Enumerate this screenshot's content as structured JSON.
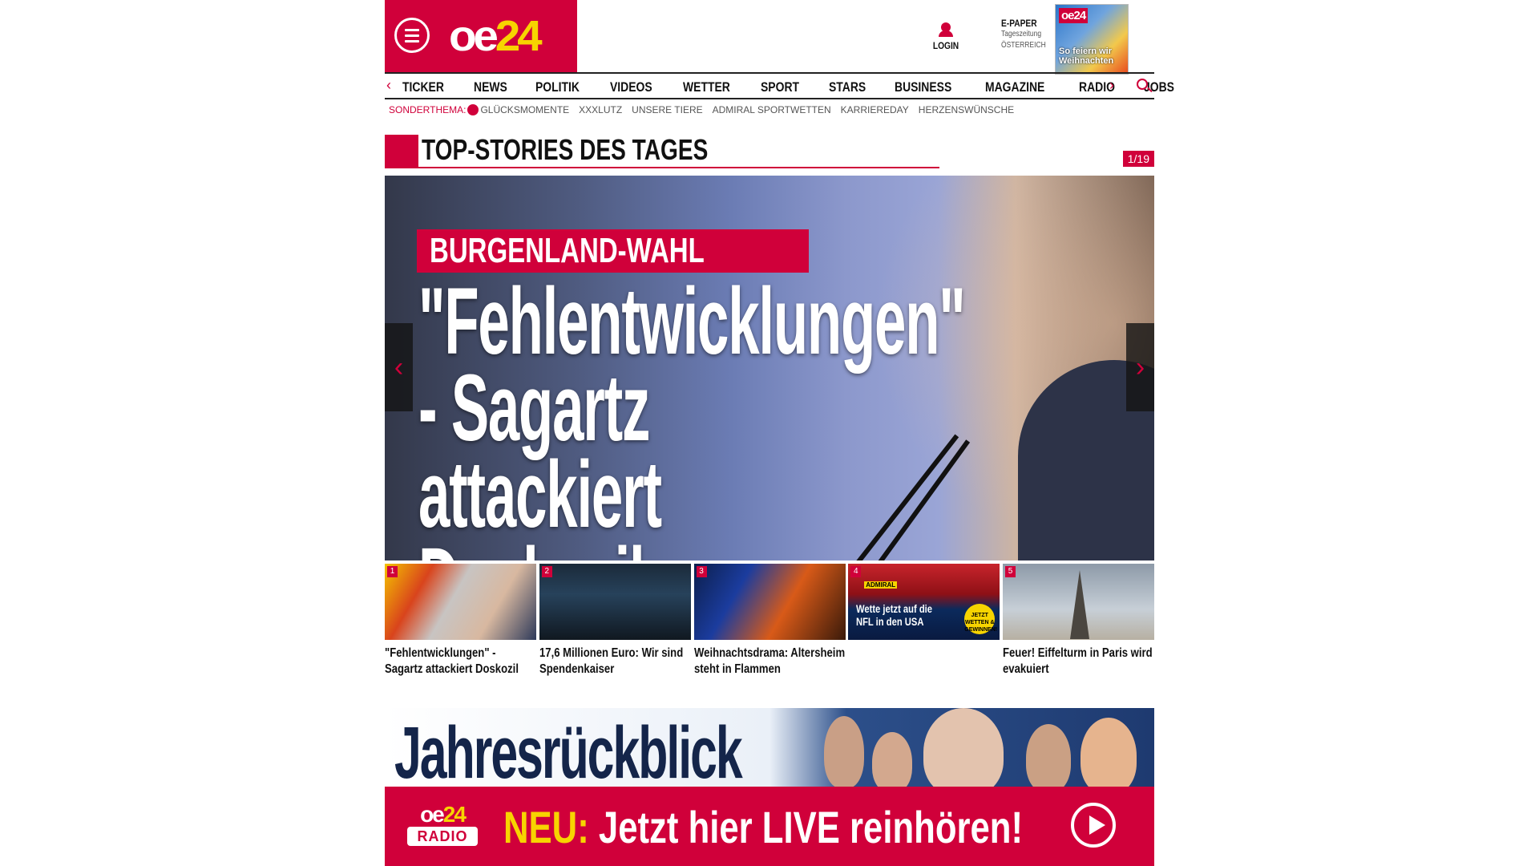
{
  "header": {
    "logo_oe": "oe",
    "logo_24": "24",
    "login_label": "LOGIN",
    "epaper_title": "E-PAPER",
    "epaper_line1": "Tageszeitung",
    "epaper_line2": "ÖSTERREICH",
    "cover_logo": "oe24",
    "cover_text": "So feiern wir Weihnachten"
  },
  "nav": {
    "prev_arrow": "‹",
    "next_arrow": "›",
    "items": [
      "TICKER",
      "NEWS",
      "POLITIK",
      "VIDEOS",
      "WETTER",
      "SPORT",
      "STARS",
      "BUSINESS",
      "MAGAZINE",
      "RADIO",
      "JOBS"
    ]
  },
  "subnav": {
    "label": "SONDERTHEMA:",
    "items": [
      "GLÜCKSMOMENTE",
      "XXXLUTZ",
      "UNSERE TIERE",
      "ADMIRAL SPORTWETTEN",
      "KARRIEREDAY",
      "HERZENSWÜNSCHE"
    ]
  },
  "section": {
    "title": "TOP-STORIES DES TAGES",
    "counter": "1/19"
  },
  "hero": {
    "tag": "BURGENLAND-WAHL",
    "title": "\"Fehlentwicklungen\" - Sagartz attackiert Doskozil",
    "prev": "‹",
    "next": "›"
  },
  "thumbs": [
    {
      "num": "1",
      "title": "\"Fehlentwicklungen\" - Sagartz attackiert Doskozil"
    },
    {
      "num": "2",
      "title": "17,6 Millionen Euro: Wir sind Spendenkaiser"
    },
    {
      "num": "3",
      "title": "Weihnachtsdrama: Altersheim steht in Flammen"
    },
    {
      "num": "4",
      "title": "",
      "ad_brand": "ADMIRAL",
      "ad_text_1": "Wette jetzt auf die",
      "ad_text_2": "NFL in den USA",
      "ad_badge": "JETZT WETTEN & GEWINNEN!"
    },
    {
      "num": "5",
      "title": "Feuer! Eiffelturm in Paris wird evakuiert"
    }
  ],
  "banner": {
    "title": "Jahresrückblick",
    "radio_logo_oe": "oe",
    "radio_logo_24": "24",
    "radio_word": "RADIO",
    "neu": "NEU:",
    "cta": " Jetzt hier LIVE reinhören!"
  },
  "colors": {
    "brand_red": "#d0003a",
    "brand_yellow": "#f7d400"
  }
}
